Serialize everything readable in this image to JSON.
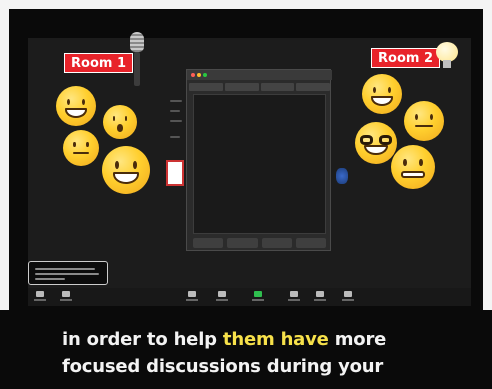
{
  "rooms": {
    "room1_label": "Room 1",
    "room2_label": "Room 2"
  },
  "emojis": {
    "left_group": [
      "grinning-face-icon",
      "hushed-face-icon",
      "thinking-face-icon",
      "beaming-face-icon"
    ],
    "right_group": [
      "star-struck-face-icon",
      "monocle-face-icon",
      "nerd-face-icon",
      "grimacing-face-icon"
    ]
  },
  "props": {
    "left": "microphone-icon",
    "right": "light-bulb-icon"
  },
  "dialog": {
    "icon": "breakout-rooms-dialog",
    "traffic_light_colors": [
      "#ff5f57",
      "#febc2e",
      "#28c840"
    ]
  },
  "toolbar": {
    "items": [
      "mute",
      "stop-video",
      "security",
      "participants",
      "share-screen",
      "chat",
      "record",
      "reactions",
      "breakout-rooms"
    ],
    "share_color": "#2fbf4f"
  },
  "caption": {
    "line1_before": "in order to help ",
    "line1_highlight": "them have",
    "line1_after": " more",
    "line2": "focused discussions during your",
    "highlight_color": "#f7e14a"
  },
  "colors": {
    "room_label_bg": "#e8232a",
    "frame": "#f4f4f4",
    "background": "#0a0a0a"
  }
}
